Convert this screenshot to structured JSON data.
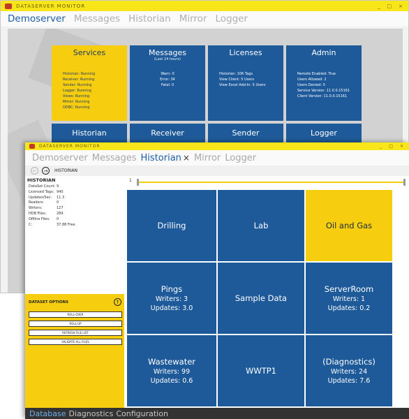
{
  "back_window": {
    "title": "DATASERVER MONITOR",
    "controls": [
      "_",
      "□",
      "×"
    ],
    "menu": [
      "Demoserver",
      "Messages",
      "Historian",
      "Mirror",
      "Logger"
    ],
    "tiles": [
      {
        "title": "Services",
        "subtitle": "",
        "lines": [
          "Historian: Running",
          "Receiver: Running",
          "Sender: Running",
          "Logger: Running",
          "Views: Running",
          "Mirror: Running",
          "ODBC: Running"
        ]
      },
      {
        "title": "Messages",
        "subtitle": "(Last 24 hours)",
        "lines": [
          "Warn: 0",
          "Error: 34",
          "Fatal: 0"
        ]
      },
      {
        "title": "Licenses",
        "subtitle": "",
        "lines": [
          "Historian: 10K Tags",
          "View Client: 5 Users",
          "View Excel Add-In: 5 Users"
        ]
      },
      {
        "title": "Admin",
        "subtitle": "",
        "lines": [
          "Remote Enabled: True",
          "Users Allowed: 2",
          "Users Denied: 0",
          "Service Version: 11.0.0.15161",
          "Client Version: 11.0.0.15161"
        ]
      }
    ],
    "tiles_row2": [
      "Historian",
      "Receiver",
      "Sender",
      "Logger"
    ]
  },
  "front_window": {
    "title": "DATASERVER MONITOR",
    "controls": [
      "_",
      "□",
      "×"
    ],
    "menu": {
      "server": "Demoserver",
      "messages": "Messages",
      "historian": "Historian",
      "close": "×",
      "mirror": "Mirror",
      "logger": "Logger"
    },
    "breadcrumb": "HISTORIAN",
    "left_panel": {
      "title": "HISTORIAN",
      "stats": [
        {
          "k": "DataSet Count:",
          "v": "9"
        },
        {
          "k": "Licensed Tags:",
          "v": "940"
        },
        {
          "k": "Updates/Sec:",
          "v": "11.3"
        },
        {
          "k": "Readers:",
          "v": "0"
        },
        {
          "k": "Writers:",
          "v": "127"
        },
        {
          "k": "HDB Files:",
          "v": "289"
        },
        {
          "k": "Offline Files:",
          "v": "0"
        },
        {
          "k": "C:",
          "v": "37.88 Free"
        }
      ]
    },
    "dataset_options": {
      "title": "DATASET OPTIONS",
      "buttons": [
        "ROLL-OVER",
        "ROLL-UP",
        "REFRESH FILE LIST",
        "VALIDATE ALL FILES"
      ]
    },
    "slider": {
      "label": "1",
      "value": 0
    },
    "datasets": [
      {
        "name": "Drilling",
        "writers": "",
        "updates": ""
      },
      {
        "name": "Lab",
        "writers": "",
        "updates": ""
      },
      {
        "name": "Oil and Gas",
        "writers": "",
        "updates": ""
      },
      {
        "name": "Pings",
        "writers": "Writers:  3",
        "updates": "Updates: 3.0"
      },
      {
        "name": "Sample Data",
        "writers": "",
        "updates": ""
      },
      {
        "name": "ServerRoom",
        "writers": "Writers:  1",
        "updates": "Updates: 0.2"
      },
      {
        "name": "Wastewater",
        "writers": "Writers:  99",
        "updates": "Updates: 0.6"
      },
      {
        "name": "WWTP1",
        "writers": "",
        "updates": ""
      },
      {
        "name": "(Diagnostics)",
        "writers": "Writers:  24",
        "updates": "Updates: 7.6"
      }
    ],
    "tabs": [
      "Database",
      "Diagnostics",
      "Configuration"
    ]
  },
  "colors": {
    "accent_blue": "#1e5a99",
    "accent_yellow": "#f7ce0f",
    "titlebar_yellow": "#f8e61a",
    "tab_active": "#6eb0ea"
  }
}
